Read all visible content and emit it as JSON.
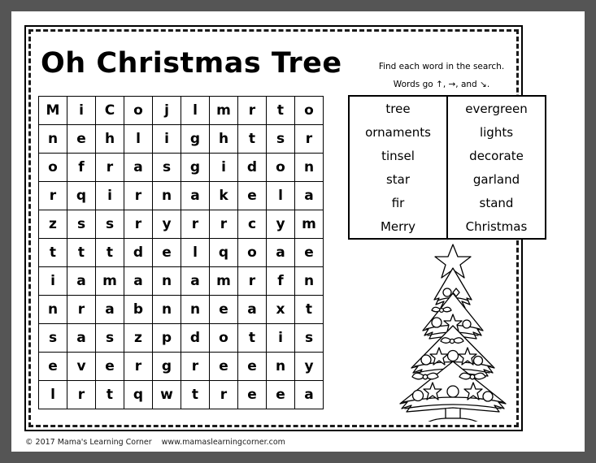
{
  "page": {
    "title": "Oh Christmas Tree",
    "background_color": "#555555",
    "paper_color": "#ffffff",
    "ink_color": "#000000"
  },
  "instructions": {
    "line1": "Find each word in the search.",
    "line2": "Words go ↑, →, and ↘."
  },
  "puzzle": {
    "rows": 11,
    "cols": 10,
    "grid": [
      [
        "M",
        "i",
        "C",
        "o",
        "j",
        "l",
        "m",
        "r",
        "t",
        "o"
      ],
      [
        "n",
        "e",
        "h",
        "l",
        "i",
        "g",
        "h",
        "t",
        "s",
        "r"
      ],
      [
        "o",
        "f",
        "r",
        "a",
        "s",
        "g",
        "i",
        "d",
        "o",
        "n"
      ],
      [
        "r",
        "q",
        "i",
        "r",
        "n",
        "a",
        "k",
        "e",
        "l",
        "a"
      ],
      [
        "z",
        "s",
        "s",
        "r",
        "y",
        "r",
        "r",
        "c",
        "y",
        "m"
      ],
      [
        "t",
        "t",
        "t",
        "d",
        "e",
        "l",
        "q",
        "o",
        "a",
        "e"
      ],
      [
        "i",
        "a",
        "m",
        "a",
        "n",
        "a",
        "m",
        "r",
        "f",
        "n"
      ],
      [
        "n",
        "r",
        "a",
        "b",
        "n",
        "n",
        "e",
        "a",
        "x",
        "t"
      ],
      [
        "s",
        "a",
        "s",
        "z",
        "p",
        "d",
        "o",
        "t",
        "i",
        "s"
      ],
      [
        "e",
        "v",
        "e",
        "r",
        "g",
        "r",
        "e",
        "e",
        "n",
        "y"
      ],
      [
        "l",
        "r",
        "t",
        "q",
        "w",
        "t",
        "r",
        "e",
        "e",
        "a"
      ]
    ]
  },
  "wordlist": {
    "rows": [
      {
        "left": "tree",
        "right": "evergreen"
      },
      {
        "left": "ornaments",
        "right": "lights"
      },
      {
        "left": "tinsel",
        "right": "decorate"
      },
      {
        "left": "star",
        "right": "garland"
      },
      {
        "left": "fir",
        "right": "stand"
      },
      {
        "left": "Merry",
        "right": "Christmas"
      }
    ]
  },
  "illustration": {
    "name": "christmas-tree",
    "description": "Black and white line-art Christmas tree with star topper, garland, ornaments, bows and a stand"
  },
  "footer": {
    "copyright": "© 2017 Mama's Learning Corner",
    "website": "www.mamaslearningcorner.com"
  }
}
